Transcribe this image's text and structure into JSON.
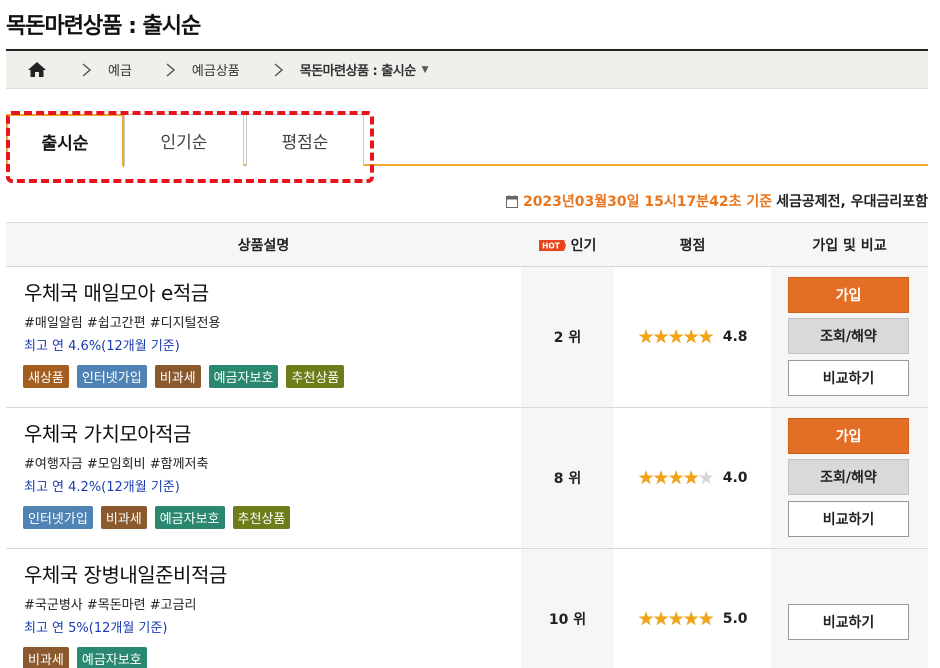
{
  "page": {
    "title": "목돈마련상품 : 출시순"
  },
  "breadcrumb": {
    "items": [
      "예금",
      "예금상품"
    ],
    "current": "목돈마련상품 : 출시순"
  },
  "tabs": [
    "출시순",
    "인기순",
    "평점순"
  ],
  "info": {
    "date": "2023년03월30일 15시17분42초 기준",
    "note": "세금공제전, 우대금리포함"
  },
  "table": {
    "headers": {
      "desc": "상품설명",
      "hot": "HOT",
      "popularity": "인기",
      "rating": "평점",
      "action": "가입 및 비교"
    }
  },
  "products": [
    {
      "name": "우체국 매일모아 e적금",
      "tags": "#매일알림 #쉽고간편 #디지털전용",
      "rate": "최고 연 4.6%(12개월 기준)",
      "badges": [
        "새상품",
        "인터넷가입",
        "비과세",
        "예금자보호",
        "추천상품"
      ],
      "rank": "2 위",
      "stars": 5,
      "score": "4.8",
      "buttons": [
        "가입",
        "조회/해약",
        "비교하기"
      ]
    },
    {
      "name": "우체국 가치모아적금",
      "tags": "#여행자금 #모임회비 #함께저축",
      "rate": "최고 연 4.2%(12개월 기준)",
      "badges": [
        "인터넷가입",
        "비과세",
        "예금자보호",
        "추천상품"
      ],
      "rank": "8 위",
      "stars": 4,
      "score": "4.0",
      "buttons": [
        "가입",
        "조회/해약",
        "비교하기"
      ]
    },
    {
      "name": "우체국 장병내일준비적금",
      "tags": "#국군병사 #목돈마련 #고금리",
      "rate": "최고 연 5%(12개월 기준)",
      "badges": [
        "비과세",
        "예금자보호"
      ],
      "rank": "10 위",
      "stars": 5,
      "score": "5.0",
      "buttons": [
        "비교하기"
      ]
    }
  ],
  "colors": {
    "accent": "#e36e26",
    "tab_border": "#f0a830",
    "highlight": "#e8141c",
    "link": "#1a3bb0",
    "date": "#e8761e"
  },
  "icons": [
    "home-icon",
    "chevron-right-icon",
    "caret-down-icon",
    "calendar-icon",
    "hot-icon",
    "star-icon"
  ]
}
